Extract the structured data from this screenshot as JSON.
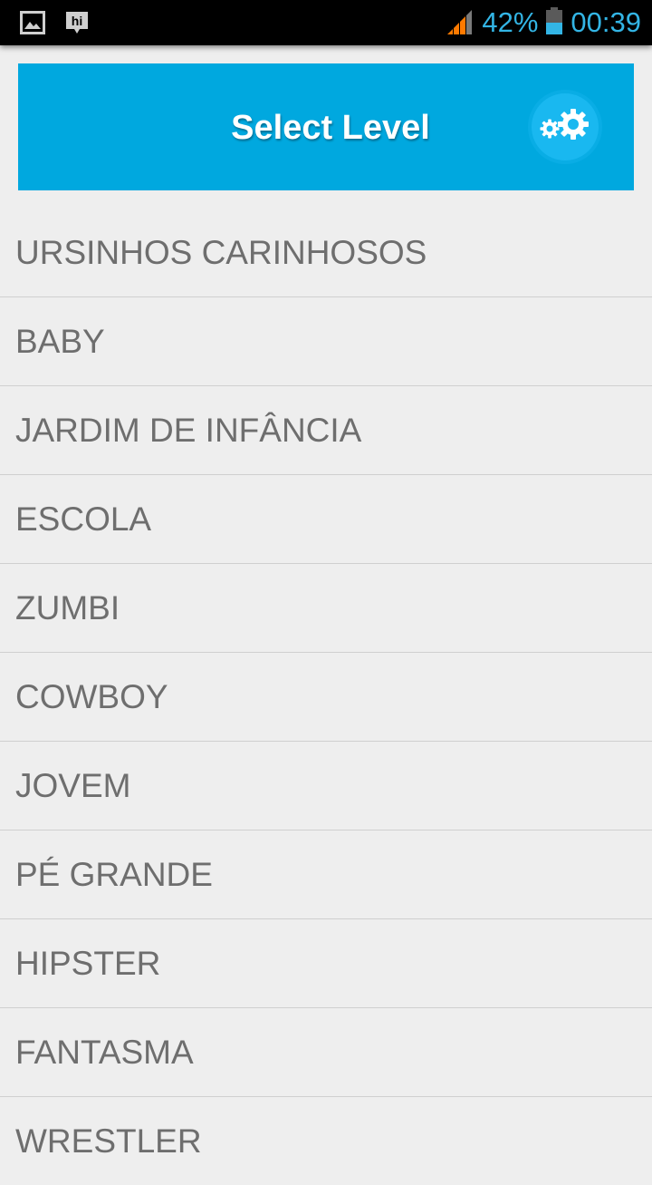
{
  "status_bar": {
    "battery_percent": "42%",
    "time": "00:39",
    "icons": [
      "gallery-icon",
      "hi-app-icon",
      "signal-icon",
      "battery-icon"
    ]
  },
  "header": {
    "title": "Select Level",
    "settings_icon": "gears-icon",
    "background_color": "#00a8df"
  },
  "levels": [
    "URSINHOS CARINHOSOS",
    "BABY",
    "JARDIM DE INFÂNCIA",
    "ESCOLA",
    "ZUMBI",
    "COWBOY",
    "JOVEM",
    "PÉ GRANDE",
    "HIPSTER",
    "FANTASMA",
    "WRESTLER"
  ]
}
